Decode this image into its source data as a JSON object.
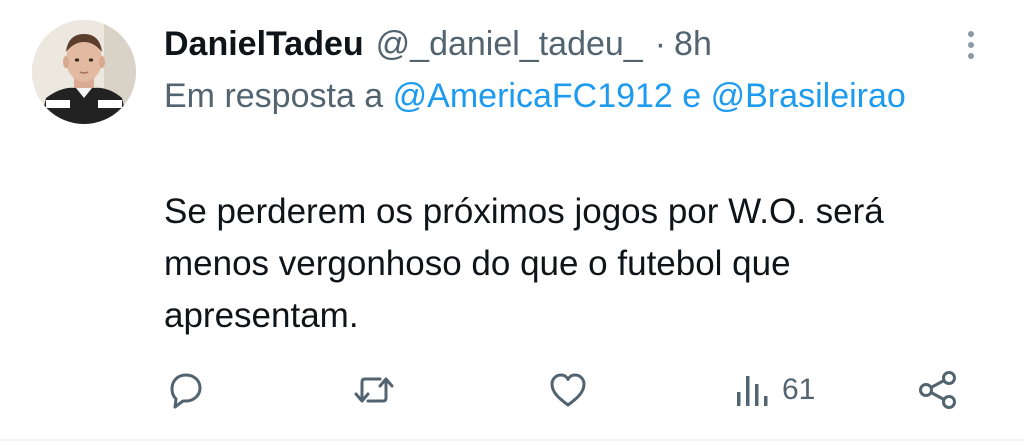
{
  "tweet": {
    "author": {
      "display_name": "DanielTadeu",
      "handle": "@_daniel_tadeu_",
      "separator": "·",
      "time": "8h"
    },
    "reply_to": {
      "prefix": "Em resposta a",
      "mention_1": "@AmericaFC1912",
      "conjunction": "e",
      "mention_2": "@Brasileirao"
    },
    "text": "Se perderem os próximos jogos por W.O. será menos vergonhoso do que o futebol que apresentam.",
    "actions": {
      "views_count": "61"
    },
    "colors": {
      "text": "#0f1419",
      "secondary": "#536471",
      "link": "#1d9bf0"
    },
    "icons": [
      "more-vertical-icon",
      "reply-icon",
      "retweet-icon",
      "like-icon",
      "views-icon",
      "share-icon"
    ]
  }
}
